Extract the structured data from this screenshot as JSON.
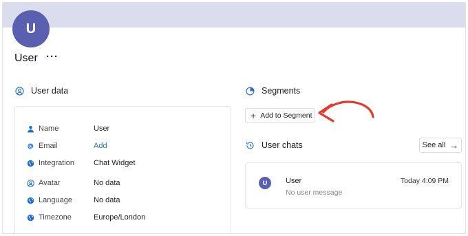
{
  "profile": {
    "avatar_initial": "U",
    "name": "User",
    "more_label": "···"
  },
  "user_data": {
    "heading": "User data",
    "rows": [
      {
        "label": "Name",
        "value": "User",
        "icon": "person-icon"
      },
      {
        "label": "Email",
        "value": "Add",
        "icon": "at-icon"
      },
      {
        "label": "Integration",
        "value": "Chat Widget",
        "icon": "globe-icon"
      },
      {
        "label": "Avatar",
        "value": "No data",
        "icon": "user-circle-icon"
      },
      {
        "label": "Language",
        "value": "No data",
        "icon": "globe-icon"
      },
      {
        "label": "Timezone",
        "value": "Europe/London",
        "icon": "globe-icon"
      }
    ]
  },
  "segments": {
    "heading": "Segments",
    "add_button": "Add to Segment"
  },
  "user_chats": {
    "heading": "User chats",
    "see_all": "See all",
    "chats": [
      {
        "initial": "U",
        "name": "User",
        "message": "No user message",
        "time": "Today 4:09 PM"
      }
    ]
  },
  "colors": {
    "accent": "#1e6fd9",
    "avatar": "#5b5fb0",
    "banner": "#dcdcef",
    "annotation_arrow": "#e8382a"
  }
}
